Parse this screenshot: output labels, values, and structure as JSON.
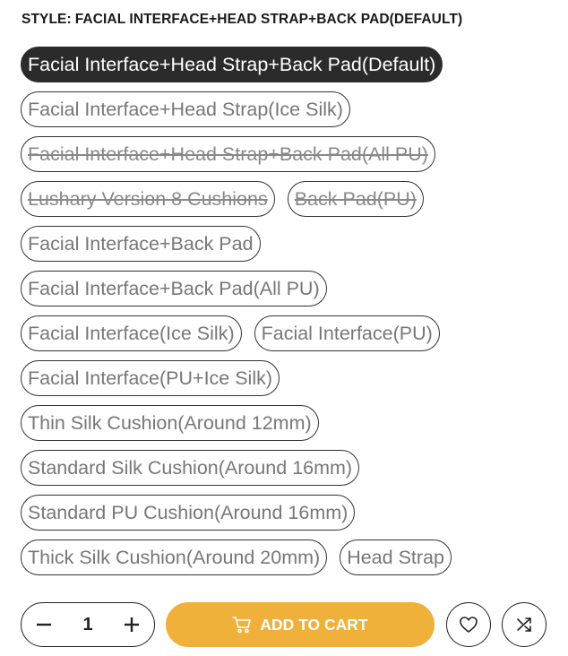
{
  "style_label": {
    "prefix": "STYLE:",
    "value": "FACIAL INTERFACE+HEAD STRAP+BACK PAD(DEFAULT)"
  },
  "options": [
    {
      "label": "Facial Interface+Head Strap+Back Pad(Default)",
      "state": "selected"
    },
    {
      "label": "Facial Interface+Head Strap(Ice Silk)",
      "state": "available"
    },
    {
      "label": "Facial Interface+Head Strap+Back Pad(All PU)",
      "state": "unavailable"
    },
    {
      "label": "Lushary Version 8 Cushions",
      "state": "unavailable"
    },
    {
      "label": "Back Pad(PU)",
      "state": "unavailable"
    },
    {
      "label": "Facial Interface+Back Pad",
      "state": "available"
    },
    {
      "label": "Facial Interface+Back Pad(All PU)",
      "state": "available"
    },
    {
      "label": "Facial Interface(Ice Silk)",
      "state": "available"
    },
    {
      "label": "Facial Interface(PU)",
      "state": "available"
    },
    {
      "label": "Facial Interface(PU+Ice Silk)",
      "state": "available"
    },
    {
      "label": "Thin Silk Cushion(Around 12mm)",
      "state": "available"
    },
    {
      "label": "Standard Silk Cushion(Around 16mm)",
      "state": "available"
    },
    {
      "label": "Standard PU Cushion(Around 16mm)",
      "state": "available"
    },
    {
      "label": "Thick Silk Cushion(Around 20mm)",
      "state": "available"
    },
    {
      "label": "Head Strap",
      "state": "available"
    }
  ],
  "cart": {
    "quantity": "1",
    "minus_icon": "minus-icon",
    "plus_icon": "plus-icon",
    "add_to_cart_label": "ADD TO CART",
    "cart_icon": "cart-icon",
    "wishlist_icon": "heart-icon",
    "compare_icon": "shuffle-icon"
  },
  "colors": {
    "selected_bg": "#2b2b2b",
    "accent": "#f0b13b",
    "border": "#333333",
    "option_text": "#777777"
  }
}
